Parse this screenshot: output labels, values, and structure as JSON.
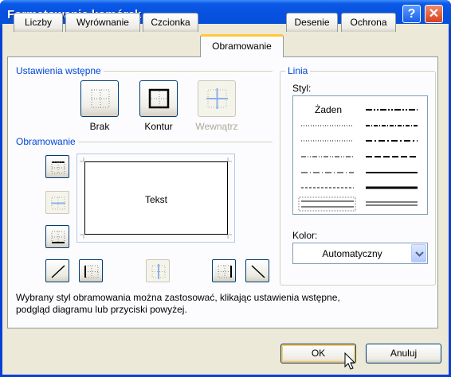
{
  "window": {
    "title": "Formatowanie komórek",
    "help_label": "?",
    "close_label": "✕"
  },
  "tabs": [
    {
      "label": "Liczby"
    },
    {
      "label": "Wyrównanie"
    },
    {
      "label": "Czcionka"
    },
    {
      "label": "Obramowanie",
      "active": true
    },
    {
      "label": "Desenie"
    },
    {
      "label": "Ochrona"
    }
  ],
  "presets": {
    "group_title": "Ustawienia wstępne",
    "items": [
      {
        "label": "Brak",
        "enabled": true
      },
      {
        "label": "Kontur",
        "enabled": true
      },
      {
        "label": "Wewnątrz",
        "enabled": false
      }
    ]
  },
  "border": {
    "group_title": "Obramowanie",
    "preview_text": "Tekst"
  },
  "line": {
    "group_title": "Linia",
    "style_label": "Styl:",
    "none_label": "Żaden",
    "color_label": "Kolor:",
    "color_value": "Automatyczny"
  },
  "description": "Wybrany styl obramowania można zastosować, klikając ustawienia wstępne, podgląd diagramu lub przyciski powyżej.",
  "buttons": {
    "ok": "OK",
    "cancel": "Anuluj"
  },
  "colors": {
    "titlebar": "#0751df",
    "group_title": "#0046d5",
    "tab_highlight": "#ffc83c",
    "dialog_bg": "#ece9d8"
  }
}
